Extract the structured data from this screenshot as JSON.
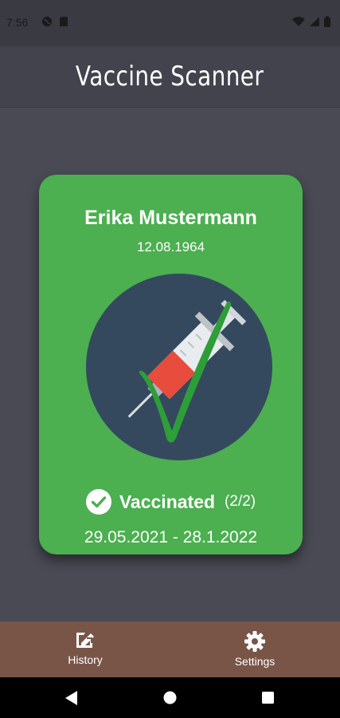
{
  "status_bar": {
    "time": "7:56",
    "left_icons": [
      "globe-icon",
      "sd-card-icon"
    ],
    "right_icons": [
      "wifi-icon",
      "signal-icon",
      "battery-icon"
    ]
  },
  "app_bar": {
    "title": "Vaccine Scanner"
  },
  "card": {
    "name": "Erika Mustermann",
    "birth_date": "12.08.1964",
    "status": "Vaccinated",
    "dose_count": "(2/2)",
    "validity": "29.05.2021 - 28.1.2022",
    "icon": "syringe-with-checkmark"
  },
  "bottom_nav": {
    "items": [
      {
        "label": "History",
        "icon": "history-icon"
      },
      {
        "label": "Settings",
        "icon": "gear-icon"
      }
    ]
  },
  "system_nav": {
    "buttons": [
      "back",
      "home",
      "recents"
    ]
  },
  "colors": {
    "background": "#4a4a55",
    "app_bar": "#42434d",
    "card": "#4caf50",
    "circle": "#34495e",
    "check": "#2e9e38",
    "bottom_nav": "#795548",
    "system_nav": "#000000"
  }
}
